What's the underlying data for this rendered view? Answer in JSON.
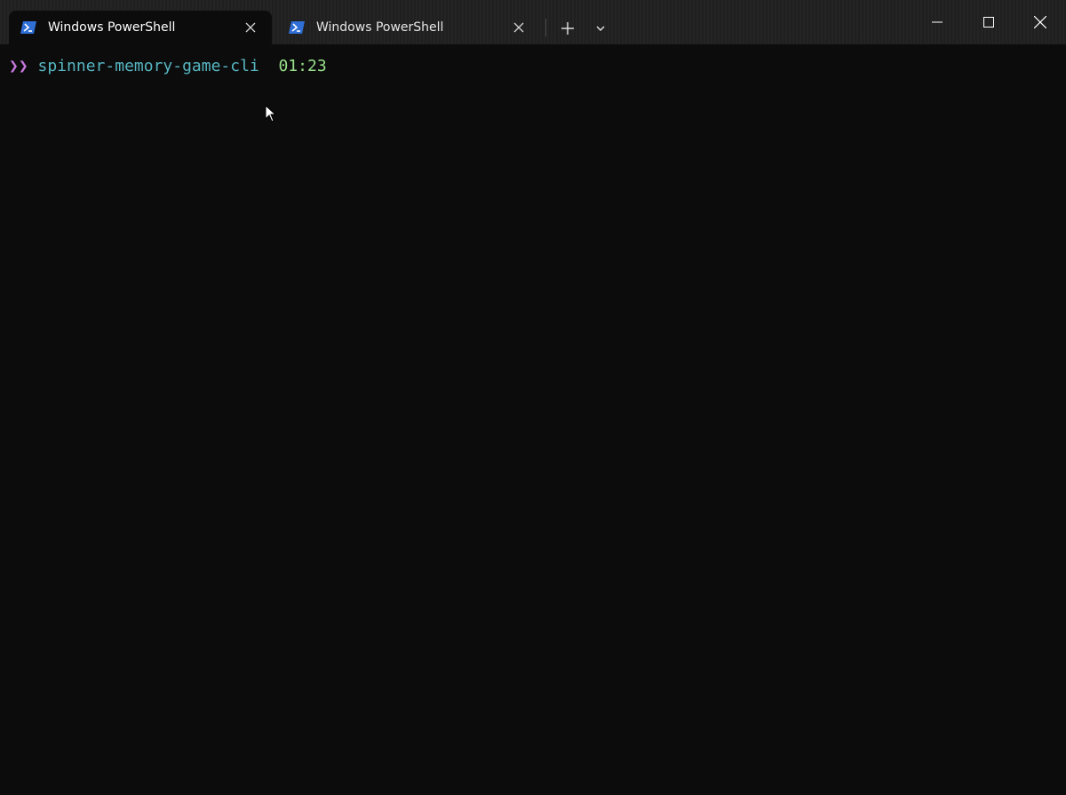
{
  "tabs": [
    {
      "title": "Windows PowerShell",
      "active": true,
      "icon": "powershell-icon"
    },
    {
      "title": "Windows PowerShell",
      "active": false,
      "icon": "powershell-icon"
    }
  ],
  "tab_actions": {
    "new_tab_icon": "plus-icon",
    "dropdown_icon": "chevron-down-icon"
  },
  "window_controls": [
    "minimize-icon",
    "maximize-icon",
    "close-icon"
  ],
  "terminal": {
    "prompt_symbol": "❯❯",
    "directory": "spinner-memory-game-cli",
    "time": "01:23"
  },
  "colors": {
    "background": "#0c0c0c",
    "titlebar": "#202020",
    "prompt_symbol": "#c678dd",
    "directory": "#56b6c2",
    "time": "#98e08a",
    "powershell_icon": "#2f6fd6"
  }
}
